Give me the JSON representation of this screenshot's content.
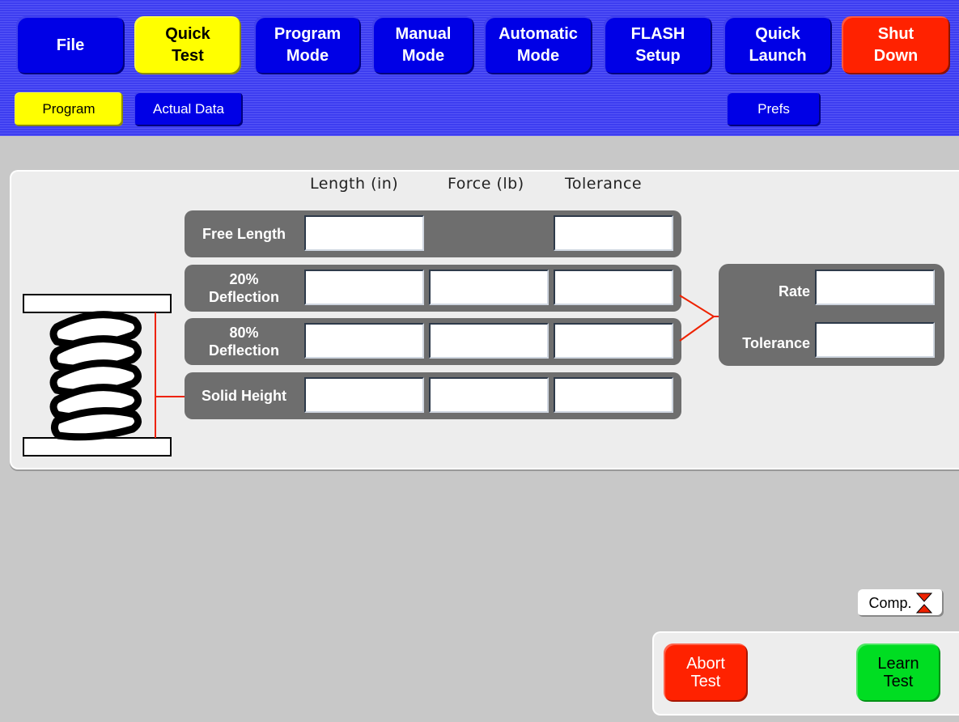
{
  "nav": {
    "file": "File",
    "quick_test": "Quick\nTest",
    "program_mode": "Program\nMode",
    "manual_mode": "Manual\nMode",
    "automatic_mode": "Automatic\nMode",
    "flash_setup": "FLASH\nSetup",
    "quick_launch": "Quick\nLaunch",
    "shut_down": "Shut\nDown"
  },
  "subnav": {
    "program": "Program",
    "actual_data": "Actual Data",
    "prefs": "Prefs"
  },
  "table": {
    "headers": {
      "length": "Length (in)",
      "force": "Force (lb)",
      "tolerance": "Tolerance"
    },
    "rows": {
      "free_length": "Free Length",
      "deflection20": "20%\nDeflection",
      "deflection80": "80%\nDeflection",
      "solid_height": "Solid Height"
    },
    "values": {
      "free_length_length": "",
      "free_length_tolerance": "",
      "d20_length": "",
      "d20_force": "",
      "d20_tolerance": "",
      "d80_length": "",
      "d80_force": "",
      "d80_tolerance": "",
      "solid_length": "",
      "solid_force": "",
      "solid_tolerance": ""
    }
  },
  "rate": {
    "rate_label": "Rate",
    "tolerance_label": "Tolerance",
    "rate_value": "",
    "tolerance_value": ""
  },
  "comp_button": "Comp.",
  "abort_test": "Abort\nTest",
  "learn_test": "Learn\nTest",
  "colors": {
    "nav_blue": "#0000e6",
    "active_yellow": "#ffff00",
    "shutdown_red": "#ff2200",
    "learn_green": "#00dd22",
    "accent_red": "#ee2200"
  },
  "icons": {
    "spring": "spring-icon",
    "comp": "compression-arrows-icon"
  }
}
